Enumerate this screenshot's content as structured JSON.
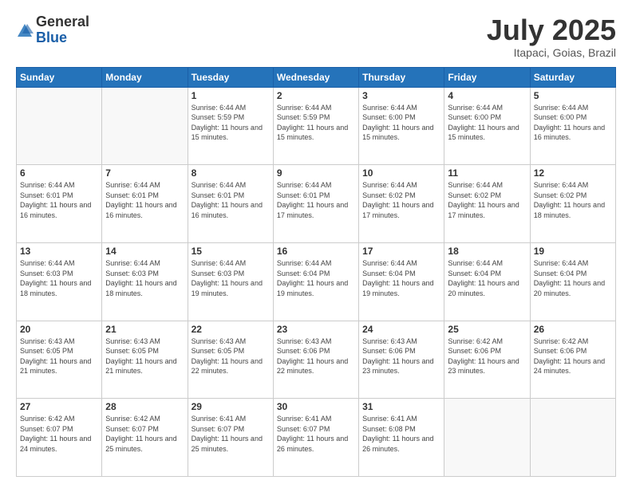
{
  "logo": {
    "general": "General",
    "blue": "Blue"
  },
  "title": "July 2025",
  "subtitle": "Itapaci, Goias, Brazil",
  "days_of_week": [
    "Sunday",
    "Monday",
    "Tuesday",
    "Wednesday",
    "Thursday",
    "Friday",
    "Saturday"
  ],
  "weeks": [
    [
      {
        "day": "",
        "info": ""
      },
      {
        "day": "",
        "info": ""
      },
      {
        "day": "1",
        "info": "Sunrise: 6:44 AM\nSunset: 5:59 PM\nDaylight: 11 hours and 15 minutes."
      },
      {
        "day": "2",
        "info": "Sunrise: 6:44 AM\nSunset: 5:59 PM\nDaylight: 11 hours and 15 minutes."
      },
      {
        "day": "3",
        "info": "Sunrise: 6:44 AM\nSunset: 6:00 PM\nDaylight: 11 hours and 15 minutes."
      },
      {
        "day": "4",
        "info": "Sunrise: 6:44 AM\nSunset: 6:00 PM\nDaylight: 11 hours and 15 minutes."
      },
      {
        "day": "5",
        "info": "Sunrise: 6:44 AM\nSunset: 6:00 PM\nDaylight: 11 hours and 16 minutes."
      }
    ],
    [
      {
        "day": "6",
        "info": "Sunrise: 6:44 AM\nSunset: 6:01 PM\nDaylight: 11 hours and 16 minutes."
      },
      {
        "day": "7",
        "info": "Sunrise: 6:44 AM\nSunset: 6:01 PM\nDaylight: 11 hours and 16 minutes."
      },
      {
        "day": "8",
        "info": "Sunrise: 6:44 AM\nSunset: 6:01 PM\nDaylight: 11 hours and 16 minutes."
      },
      {
        "day": "9",
        "info": "Sunrise: 6:44 AM\nSunset: 6:01 PM\nDaylight: 11 hours and 17 minutes."
      },
      {
        "day": "10",
        "info": "Sunrise: 6:44 AM\nSunset: 6:02 PM\nDaylight: 11 hours and 17 minutes."
      },
      {
        "day": "11",
        "info": "Sunrise: 6:44 AM\nSunset: 6:02 PM\nDaylight: 11 hours and 17 minutes."
      },
      {
        "day": "12",
        "info": "Sunrise: 6:44 AM\nSunset: 6:02 PM\nDaylight: 11 hours and 18 minutes."
      }
    ],
    [
      {
        "day": "13",
        "info": "Sunrise: 6:44 AM\nSunset: 6:03 PM\nDaylight: 11 hours and 18 minutes."
      },
      {
        "day": "14",
        "info": "Sunrise: 6:44 AM\nSunset: 6:03 PM\nDaylight: 11 hours and 18 minutes."
      },
      {
        "day": "15",
        "info": "Sunrise: 6:44 AM\nSunset: 6:03 PM\nDaylight: 11 hours and 19 minutes."
      },
      {
        "day": "16",
        "info": "Sunrise: 6:44 AM\nSunset: 6:04 PM\nDaylight: 11 hours and 19 minutes."
      },
      {
        "day": "17",
        "info": "Sunrise: 6:44 AM\nSunset: 6:04 PM\nDaylight: 11 hours and 19 minutes."
      },
      {
        "day": "18",
        "info": "Sunrise: 6:44 AM\nSunset: 6:04 PM\nDaylight: 11 hours and 20 minutes."
      },
      {
        "day": "19",
        "info": "Sunrise: 6:44 AM\nSunset: 6:04 PM\nDaylight: 11 hours and 20 minutes."
      }
    ],
    [
      {
        "day": "20",
        "info": "Sunrise: 6:43 AM\nSunset: 6:05 PM\nDaylight: 11 hours and 21 minutes."
      },
      {
        "day": "21",
        "info": "Sunrise: 6:43 AM\nSunset: 6:05 PM\nDaylight: 11 hours and 21 minutes."
      },
      {
        "day": "22",
        "info": "Sunrise: 6:43 AM\nSunset: 6:05 PM\nDaylight: 11 hours and 22 minutes."
      },
      {
        "day": "23",
        "info": "Sunrise: 6:43 AM\nSunset: 6:06 PM\nDaylight: 11 hours and 22 minutes."
      },
      {
        "day": "24",
        "info": "Sunrise: 6:43 AM\nSunset: 6:06 PM\nDaylight: 11 hours and 23 minutes."
      },
      {
        "day": "25",
        "info": "Sunrise: 6:42 AM\nSunset: 6:06 PM\nDaylight: 11 hours and 23 minutes."
      },
      {
        "day": "26",
        "info": "Sunrise: 6:42 AM\nSunset: 6:06 PM\nDaylight: 11 hours and 24 minutes."
      }
    ],
    [
      {
        "day": "27",
        "info": "Sunrise: 6:42 AM\nSunset: 6:07 PM\nDaylight: 11 hours and 24 minutes."
      },
      {
        "day": "28",
        "info": "Sunrise: 6:42 AM\nSunset: 6:07 PM\nDaylight: 11 hours and 25 minutes."
      },
      {
        "day": "29",
        "info": "Sunrise: 6:41 AM\nSunset: 6:07 PM\nDaylight: 11 hours and 25 minutes."
      },
      {
        "day": "30",
        "info": "Sunrise: 6:41 AM\nSunset: 6:07 PM\nDaylight: 11 hours and 26 minutes."
      },
      {
        "day": "31",
        "info": "Sunrise: 6:41 AM\nSunset: 6:08 PM\nDaylight: 11 hours and 26 minutes."
      },
      {
        "day": "",
        "info": ""
      },
      {
        "day": "",
        "info": ""
      }
    ]
  ]
}
